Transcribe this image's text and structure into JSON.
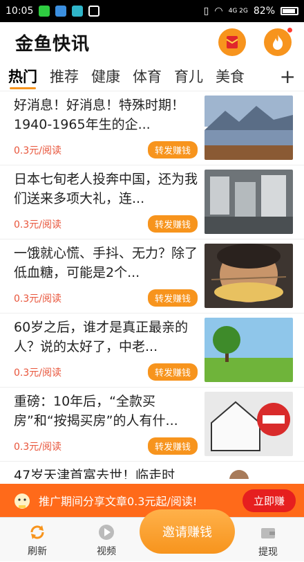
{
  "status_bar": {
    "time": "10:05",
    "battery": "82%",
    "network": "4G 2G"
  },
  "header": {
    "title": "金鱼快讯"
  },
  "tabs": [
    {
      "label": "热门",
      "active": true
    },
    {
      "label": "推荐",
      "active": false
    },
    {
      "label": "健康",
      "active": false
    },
    {
      "label": "体育",
      "active": false
    },
    {
      "label": "育儿",
      "active": false
    },
    {
      "label": "美食",
      "active": false
    }
  ],
  "tabs_more": "+",
  "feed": [
    {
      "title": "好消息！好消息！特殊时期！1940-1965年生的企...",
      "price": "0.3元/阅读",
      "action": "转发赚钱"
    },
    {
      "title": "日本七旬老人投奔中国，还为我们送来多项大礼，连...",
      "price": "0.3元/阅读",
      "action": "转发赚钱"
    },
    {
      "title": "一饿就心慌、手抖、无力？除了低血糖，可能是2个...",
      "price": "0.3元/阅读",
      "action": "转发赚钱"
    },
    {
      "title": "60岁之后，谁才是真正最亲的人？说的太好了，中老...",
      "price": "0.3元/阅读",
      "action": "转发赚钱"
    },
    {
      "title": "重磅：10年后，“全款买房”和“按揭买房”的人有什...",
      "price": "0.3元/阅读",
      "action": "转发赚钱"
    },
    {
      "title": "47岁天津首富去世！临走时",
      "price": "",
      "action": ""
    }
  ],
  "promo": {
    "text": "推广期间分享文章0.3元起/阅读!",
    "button": "立即赚"
  },
  "bottom_nav": {
    "refresh": "刷新",
    "video": "视频",
    "invite": "邀请赚钱",
    "withdraw": "提现"
  }
}
